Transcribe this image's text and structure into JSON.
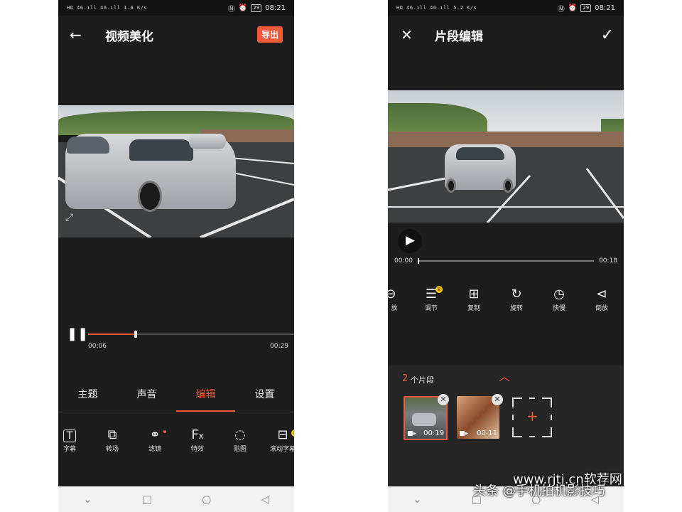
{
  "status_bar": {
    "left_text": "HD 46.ıll 46.ıll 1.6 K/s",
    "left_text_2": "HD 46.ıll 46.ıll 5.2 K/s",
    "battery": "29",
    "time": "08:21"
  },
  "screen1": {
    "back_icon": "arrow-left-icon",
    "title": "视频美化",
    "export_label": "导出",
    "current_time": "00:06",
    "total_time": "00:29",
    "progress": 0.23,
    "tabs": [
      "主题",
      "声音",
      "编辑",
      "设置"
    ],
    "active_tab": "编辑",
    "tools": [
      {
        "label": "字幕",
        "icon": "text-icon"
      },
      {
        "label": "转场",
        "icon": "transition-icon"
      },
      {
        "label": "滤镜",
        "icon": "filter-icon"
      },
      {
        "label": "特效",
        "icon": "effects-icon"
      },
      {
        "label": "贴图",
        "icon": "sticker-icon"
      },
      {
        "label": "滚动字幕",
        "icon": "scroll-text-icon"
      }
    ]
  },
  "screen2": {
    "close_icon": "close-icon",
    "title": "片段编辑",
    "confirm_icon": "check-icon",
    "current_time": "00:00",
    "total_time": "00:18",
    "tools": [
      {
        "label": "放",
        "icon": "zoom-icon"
      },
      {
        "label": "调节",
        "icon": "adjust-icon"
      },
      {
        "label": "复制",
        "icon": "copy-icon"
      },
      {
        "label": "旋转",
        "icon": "rotate-90-icon"
      },
      {
        "label": "快慢",
        "icon": "speed-icon"
      },
      {
        "label": "倒放",
        "icon": "reverse-icon"
      }
    ],
    "segment_count": "2",
    "segment_label": "个片段",
    "clips": [
      {
        "duration": "00:19"
      },
      {
        "duration": "00:11"
      }
    ]
  },
  "watermark": {
    "site": "www.rjtj.cn软荐网",
    "author": "头条 @手机拍机影技巧"
  },
  "colors": {
    "accent": "#ee5a3a",
    "background": "#1d1d1d",
    "crown": "#f5c518"
  }
}
